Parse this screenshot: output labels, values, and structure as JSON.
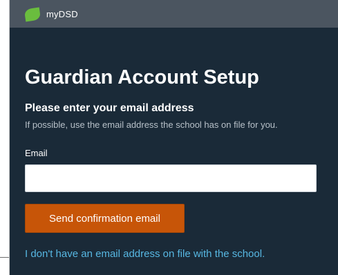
{
  "header": {
    "brand": "myDSD",
    "logo_icon": "green-leaf-icon"
  },
  "main": {
    "title": "Guardian Account Setup",
    "subtitle": "Please enter your email address",
    "hint": "If possible, use the email address the school has on file for you.",
    "email_label": "Email",
    "email_value": "",
    "email_placeholder": "",
    "send_button_label": "Send confirmation email",
    "no_email_link": "I don't have an email address on file with the school."
  },
  "colors": {
    "background": "#1a2a38",
    "topbar": "#4b5560",
    "accent_button": "#c75508",
    "link": "#57b7e2",
    "logo": "#6abd3e"
  }
}
